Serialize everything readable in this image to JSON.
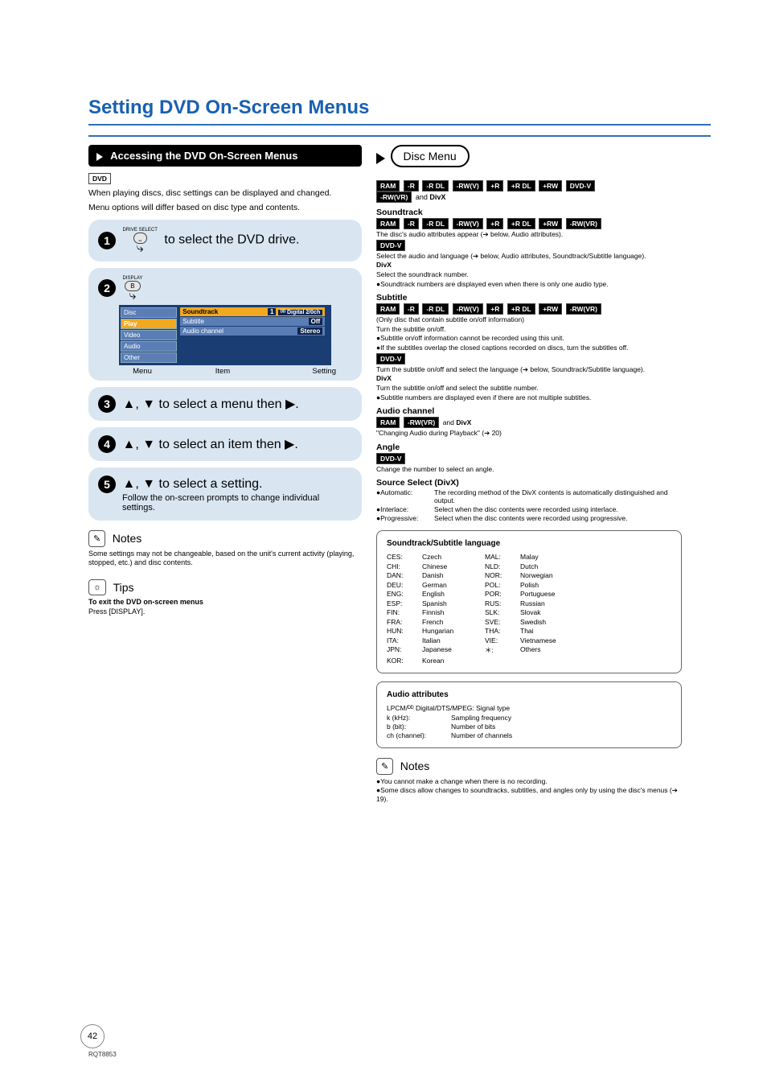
{
  "title": "Setting DVD On-Screen Menus",
  "pageNumber": "42",
  "footerCode": "RQT8853",
  "left": {
    "sectionTitle": "Accessing the DVD On-Screen Menus",
    "mediaTag": "DVD",
    "intro1": "When playing discs, disc settings can be displayed and changed.",
    "intro2": "Menu options will differ based on disc type and contents.",
    "step1": {
      "num": "1",
      "button": "DRIVE\nSELECT",
      "text": "to select the DVD drive."
    },
    "step2": {
      "num": "2",
      "button1": "DISPLAY",
      "button2": "B",
      "osd": {
        "menu": [
          "Disc",
          "Play",
          "Video",
          "Audio",
          "Other"
        ],
        "selectedMenu": 1,
        "rows": [
          {
            "label": "Soundtrack",
            "value": "1",
            "extra": "ᴰᴰ Digital 2/0ch",
            "sel": true
          },
          {
            "label": "Subtitle",
            "value": "Off"
          },
          {
            "label": "Audio channel",
            "value": "Stereo"
          }
        ],
        "labels": [
          "Menu",
          "Item",
          "Setting"
        ]
      }
    },
    "step3": {
      "num": "3",
      "text": "▲, ▼ to select a menu then ▶."
    },
    "step4": {
      "num": "4",
      "text": "▲, ▼ to select an item then ▶."
    },
    "step5": {
      "num": "5",
      "text": "▲, ▼ to select a setting.",
      "sub": "Follow the on-screen prompts to change individual settings."
    },
    "notes": {
      "heading": "Notes",
      "body": "Some settings may not be changeable, based on the unit's current activity (playing, stopped, etc.) and disc contents."
    },
    "tips": {
      "heading": "Tips",
      "b": "To exit the DVD on-screen menus",
      "body": "Press [DISPLAY]."
    }
  },
  "right": {
    "discMenuTitle": "Disc Menu",
    "topMedia": [
      "RAM",
      "-R",
      "-R DL",
      "-RW(V)",
      "+R",
      "+R DL",
      "+RW",
      "DVD-V",
      "-RW(VR)"
    ],
    "topAnd": "and",
    "topDivx": "DivX",
    "soundtrack": {
      "hd": "Soundtrack",
      "media": [
        "RAM",
        "-R",
        "-R DL",
        "-RW(V)",
        "+R",
        "+R DL",
        "+RW",
        "-RW(VR)"
      ],
      "l1": "The disc's audio attributes appear (➔ below, Audio attributes).",
      "tag2": "DVD-V",
      "l2": "Select the audio and language (➔ below, Audio attributes, Soundtrack/Subtitle language).",
      "divx": "DivX",
      "l3": "Select the soundtrack number.",
      "l4": "●Soundtrack numbers are displayed even when there is only one audio type."
    },
    "subtitle": {
      "hd": "Subtitle",
      "media": [
        "RAM",
        "-R",
        "-R DL",
        "-RW(V)",
        "+R",
        "+R DL",
        "+RW",
        "-RW(VR)"
      ],
      "l1": "(Only disc that contain subtitle on/off information)",
      "l2": "Turn the subtitle on/off.",
      "l3": "●Subtitle on/off information cannot be recorded using this unit.",
      "l4": "●If the subtitles overlap the closed captions recorded on discs, turn the subtitles off.",
      "tag2": "DVD-V",
      "l5": "Turn the subtitle on/off and select the language (➔ below, Soundtrack/Subtitle language).",
      "divx": "DivX",
      "l6": "Turn the subtitle on/off and select the subtitle number.",
      "l7": "●Subtitle numbers are displayed even if there are not multiple subtitles."
    },
    "audio": {
      "hd": "Audio channel",
      "media": [
        "RAM",
        "-RW(VR)"
      ],
      "and": "and",
      "divx": "DivX",
      "l1": "\"Changing Audio during Playback\" (➔ 20)"
    },
    "angle": {
      "hd": "Angle",
      "tag": "DVD-V",
      "l1": "Change the number to select an angle."
    },
    "source": {
      "hd": "Source Select (DivX)",
      "rows": [
        {
          "k": "●Automatic:",
          "v": "The recording method of the DivX contents is automatically distinguished and output."
        },
        {
          "k": "●Interlace:",
          "v": "Select when the disc contents were recorded using interlace."
        },
        {
          "k": "●Progressive:",
          "v": "Select when the disc contents were recorded using progressive."
        }
      ]
    },
    "langCard": {
      "title": "Soundtrack/Subtitle language",
      "rows": [
        [
          "CES:",
          "Czech",
          "MAL:",
          "Malay"
        ],
        [
          "CHI:",
          "Chinese",
          "NLD:",
          "Dutch"
        ],
        [
          "DAN:",
          "Danish",
          "NOR:",
          "Norwegian"
        ],
        [
          "DEU:",
          "German",
          "POL:",
          "Polish"
        ],
        [
          "ENG:",
          "English",
          "POR:",
          "Portuguese"
        ],
        [
          "ESP:",
          "Spanish",
          "RUS:",
          "Russian"
        ],
        [
          "FIN:",
          "Finnish",
          "SLK:",
          "Slovak"
        ],
        [
          "FRA:",
          "French",
          "SVE:",
          "Swedish"
        ],
        [
          "HUN:",
          "Hungarian",
          "THA:",
          "Thai"
        ],
        [
          "ITA:",
          "Italian",
          "VIE:",
          "Vietnamese"
        ],
        [
          "JPN:",
          "Japanese",
          "＊:",
          "Others"
        ],
        [
          "KOR:",
          "Korean",
          "",
          ""
        ]
      ]
    },
    "attrCard": {
      "title": "Audio attributes",
      "l1": "LPCM/ᴰᴰ Digital/DTS/MPEG: Signal type",
      "rows": [
        [
          "k (kHz):",
          "Sampling frequency"
        ],
        [
          "b (bit):",
          "Number of bits"
        ],
        [
          "ch (channel):",
          "Number of channels"
        ]
      ]
    },
    "notes": {
      "heading": "Notes",
      "l1": "●You cannot make a change when there is no recording.",
      "l2": "●Some discs allow changes to soundtracks, subtitles, and angles only by using the disc's menus (➔ 19)."
    }
  }
}
